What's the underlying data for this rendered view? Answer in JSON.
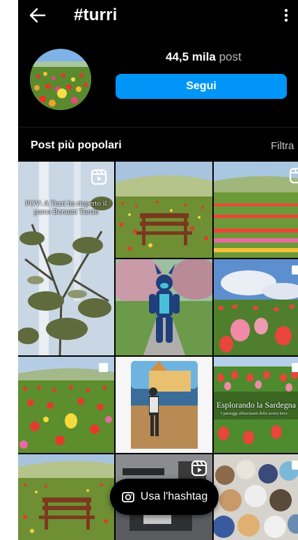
{
  "header": {
    "title": "#turri",
    "back_icon": "arrow-left-icon",
    "more_icon": "more-vertical-icon"
  },
  "hashtag": {
    "post_count": "44,5 mila",
    "post_count_label": "post",
    "follow_label": "Segui"
  },
  "section": {
    "title": "Post più popolari",
    "filter_label": "Filtra"
  },
  "tiles": {
    "t1_caption": "POV: A Turri ha riaperto il parco Berauni Turrin",
    "t9_caption": "Esplorando la Sardegna",
    "t9_subcaption": "I paesaggi affascinanti della nostra terra"
  },
  "fab": {
    "label": "Usa l'hashtag",
    "icon": "camera-icon"
  },
  "colors": {
    "background": "#000000",
    "follow_button": "#0095f6",
    "muted_text": "#b5b5b5"
  }
}
